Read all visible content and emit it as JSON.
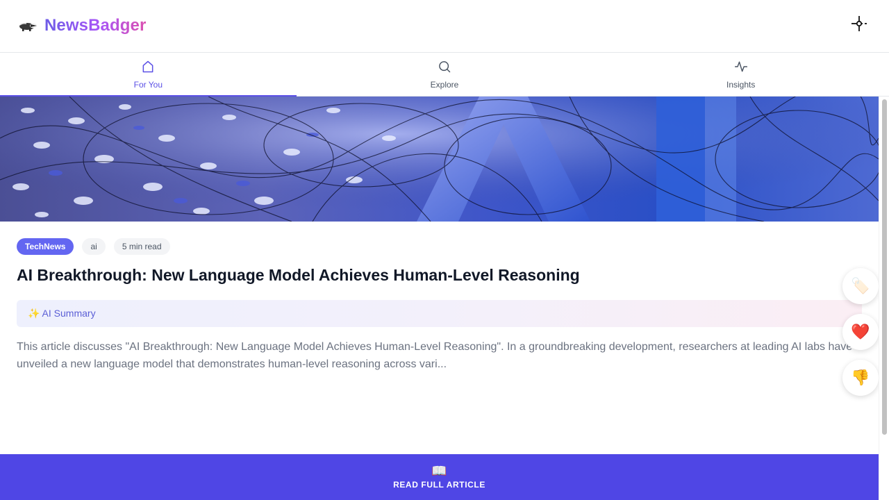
{
  "app": {
    "name": "NewsBadger",
    "logo_icon": "badger-icon",
    "settings_icon": "settings-toggle-icon"
  },
  "tabs": [
    {
      "label": "For You",
      "icon": "home-icon",
      "active": true
    },
    {
      "label": "Explore",
      "icon": "search-icon",
      "active": false
    },
    {
      "label": "Insights",
      "icon": "activity-icon",
      "active": false
    }
  ],
  "article": {
    "source": "TechNews",
    "tag": "ai",
    "read_time": "5 min read",
    "title": "AI Breakthrough: New Language Model Achieves Human-Level Reasoning",
    "summary_label": "✨ AI Summary",
    "excerpt": "This article discusses \"AI Breakthrough: New Language Model Achieves Human-Level Reasoning\". In a groundbreaking development, researchers at leading AI labs have unveiled a new language model that demonstrates human-level reasoning across vari..."
  },
  "actions": [
    {
      "icon": "tag-icon",
      "glyph": "🏷️"
    },
    {
      "icon": "heart-icon",
      "glyph": "❤️"
    },
    {
      "icon": "thumbs-down-icon",
      "glyph": "👎"
    }
  ],
  "cta": {
    "label": "READ FULL ARTICLE",
    "icon": "open-book-icon",
    "glyph": "📖"
  },
  "colors": {
    "accent": "#5b50e6",
    "cta_bg": "#4f46e5",
    "source_pill": "#6366f1"
  }
}
